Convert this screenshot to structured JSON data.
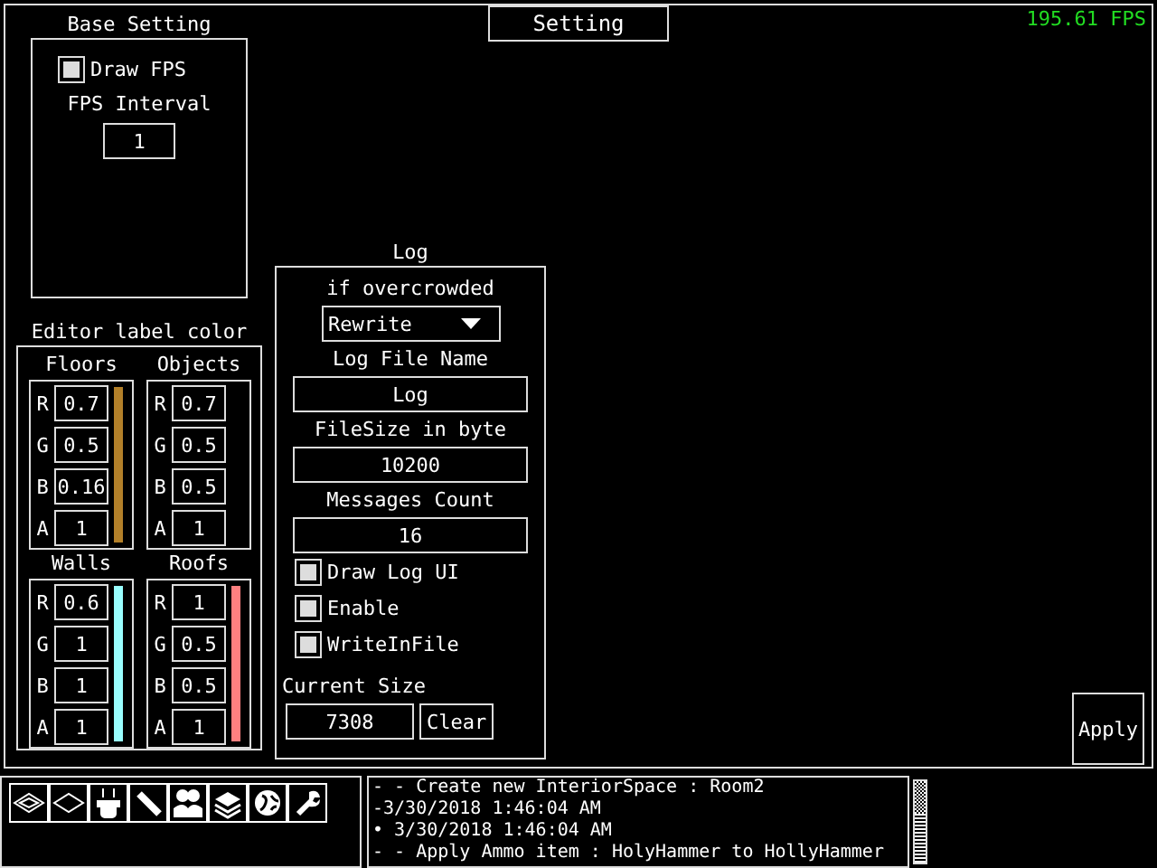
{
  "fps_counter": "195.61 FPS",
  "setting_tab": {
    "title": "Setting"
  },
  "base_setting": {
    "title": "Base Setting",
    "draw_fps": {
      "label": "Draw FPS",
      "checked": true
    },
    "fps_interval": {
      "label": "FPS Interval",
      "value": "1"
    }
  },
  "editor_label_color": {
    "title": "Editor label color",
    "groups": [
      {
        "name": "Floors",
        "color": "#b38029",
        "fields": [
          {
            "label": "R",
            "value": "0.7"
          },
          {
            "label": "G",
            "value": "0.5"
          },
          {
            "label": "B",
            "value": "0.16"
          },
          {
            "label": "A",
            "value": "1"
          }
        ]
      },
      {
        "name": "Objects",
        "fields": [
          {
            "label": "R",
            "value": "0.7"
          },
          {
            "label": "G",
            "value": "0.5"
          },
          {
            "label": "B",
            "value": "0.5"
          },
          {
            "label": "A",
            "value": "1"
          }
        ]
      },
      {
        "name": "Walls",
        "color": "#99ffff",
        "fields": [
          {
            "label": "R",
            "value": "0.6"
          },
          {
            "label": "G",
            "value": "1"
          },
          {
            "label": "B",
            "value": "1"
          },
          {
            "label": "A",
            "value": "1"
          }
        ]
      },
      {
        "name": "Roofs",
        "color": "#ff8080",
        "fields": [
          {
            "label": "R",
            "value": "1"
          },
          {
            "label": "G",
            "value": "0.5"
          },
          {
            "label": "B",
            "value": "0.5"
          },
          {
            "label": "A",
            "value": "1"
          }
        ]
      }
    ]
  },
  "log": {
    "title": "Log",
    "overcrowd_label": "if overcrowded",
    "overcrowd_mode": "Rewrite",
    "file_name_label": "Log File Name",
    "file_name": "Log",
    "file_size_label": "FileSize in byte",
    "file_size": "10200",
    "messages_label": "Messages Count",
    "messages_count": "16",
    "options": [
      {
        "label": "Draw Log UI",
        "checked": true
      },
      {
        "label": "Enable",
        "checked": true
      },
      {
        "label": "WriteInFile",
        "checked": true
      }
    ],
    "current_size_label": "Current Size",
    "current_size": "7308",
    "clear_button": "Clear"
  },
  "apply_button": "Apply",
  "console": {
    "lines": [
      "- - Create new InteriorSpace : Room2",
      "-3/30/2018 1:46:04 AM",
      "• 3/30/2018 1:46:04 AM",
      "- - Apply Ammo item : HolyHammer to HollyHammer"
    ]
  }
}
